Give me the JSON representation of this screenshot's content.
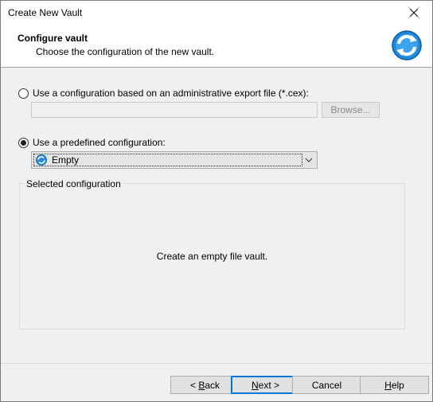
{
  "window": {
    "title": "Create New Vault"
  },
  "header": {
    "title": "Configure vault",
    "subtitle": "Choose the configuration of the new vault.",
    "logo_icon": "vault-refresh-icon"
  },
  "options": {
    "export_file": {
      "label": "Use a configuration based on an administrative export file (*.cex):",
      "selected": false,
      "file_value": "",
      "browse_label": "Browse..."
    },
    "predefined": {
      "label": "Use a predefined configuration:",
      "selected": true,
      "selected_value": "Empty"
    }
  },
  "selected_configuration": {
    "legend": "Selected configuration",
    "description": "Create an empty file vault."
  },
  "buttons": {
    "back": {
      "prefix": "< ",
      "mnemonic": "B",
      "rest": "ack"
    },
    "next": {
      "mnemonic": "N",
      "rest": "ext >"
    },
    "cancel": "Cancel",
    "help": {
      "mnemonic": "H",
      "rest": "elp"
    }
  },
  "colors": {
    "accent": "#0078d7",
    "dialog_bg": "#f0f0f0",
    "header_bg": "#ffffff"
  }
}
